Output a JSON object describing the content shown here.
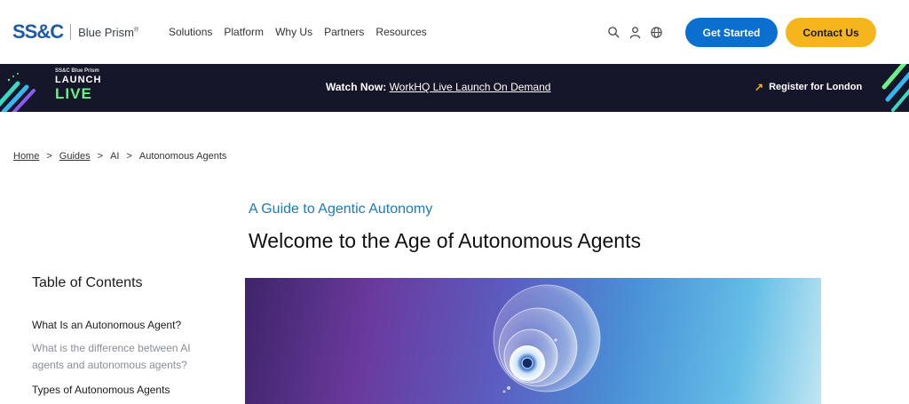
{
  "header": {
    "logo_mark": "SS&C",
    "logo_text": "Blue Prism",
    "nav": [
      "Solutions",
      "Platform",
      "Why Us",
      "Partners",
      "Resources"
    ],
    "icons": [
      "search-icon",
      "user-icon",
      "globe-icon"
    ],
    "get_started": "Get Started",
    "contact_us": "Contact Us",
    "colors": {
      "primary": "#0a6fcf",
      "accent": "#f7b51d"
    }
  },
  "banner": {
    "badge_small": "SS&C Blue Prism",
    "badge_launch": "LAUNCH",
    "badge_live": "LIVE",
    "watch_label": "Watch Now:",
    "watch_link": "WorkHQ Live Launch On Demand",
    "register": "Register for London",
    "background": "#15162a"
  },
  "breadcrumb": {
    "items": [
      "Home",
      "Guides",
      "AI",
      "Autonomous Agents"
    ],
    "separator": ">"
  },
  "main": {
    "eyebrow": "A Guide to Agentic Autonomy",
    "title": "Welcome to the Age of Autonomous Agents"
  },
  "toc": {
    "title": "Table of Contents",
    "items": [
      "What Is an Autonomous Agent?",
      "What is the difference between AI agents and autonomous agents?",
      "Types of Autonomous Agents"
    ]
  }
}
